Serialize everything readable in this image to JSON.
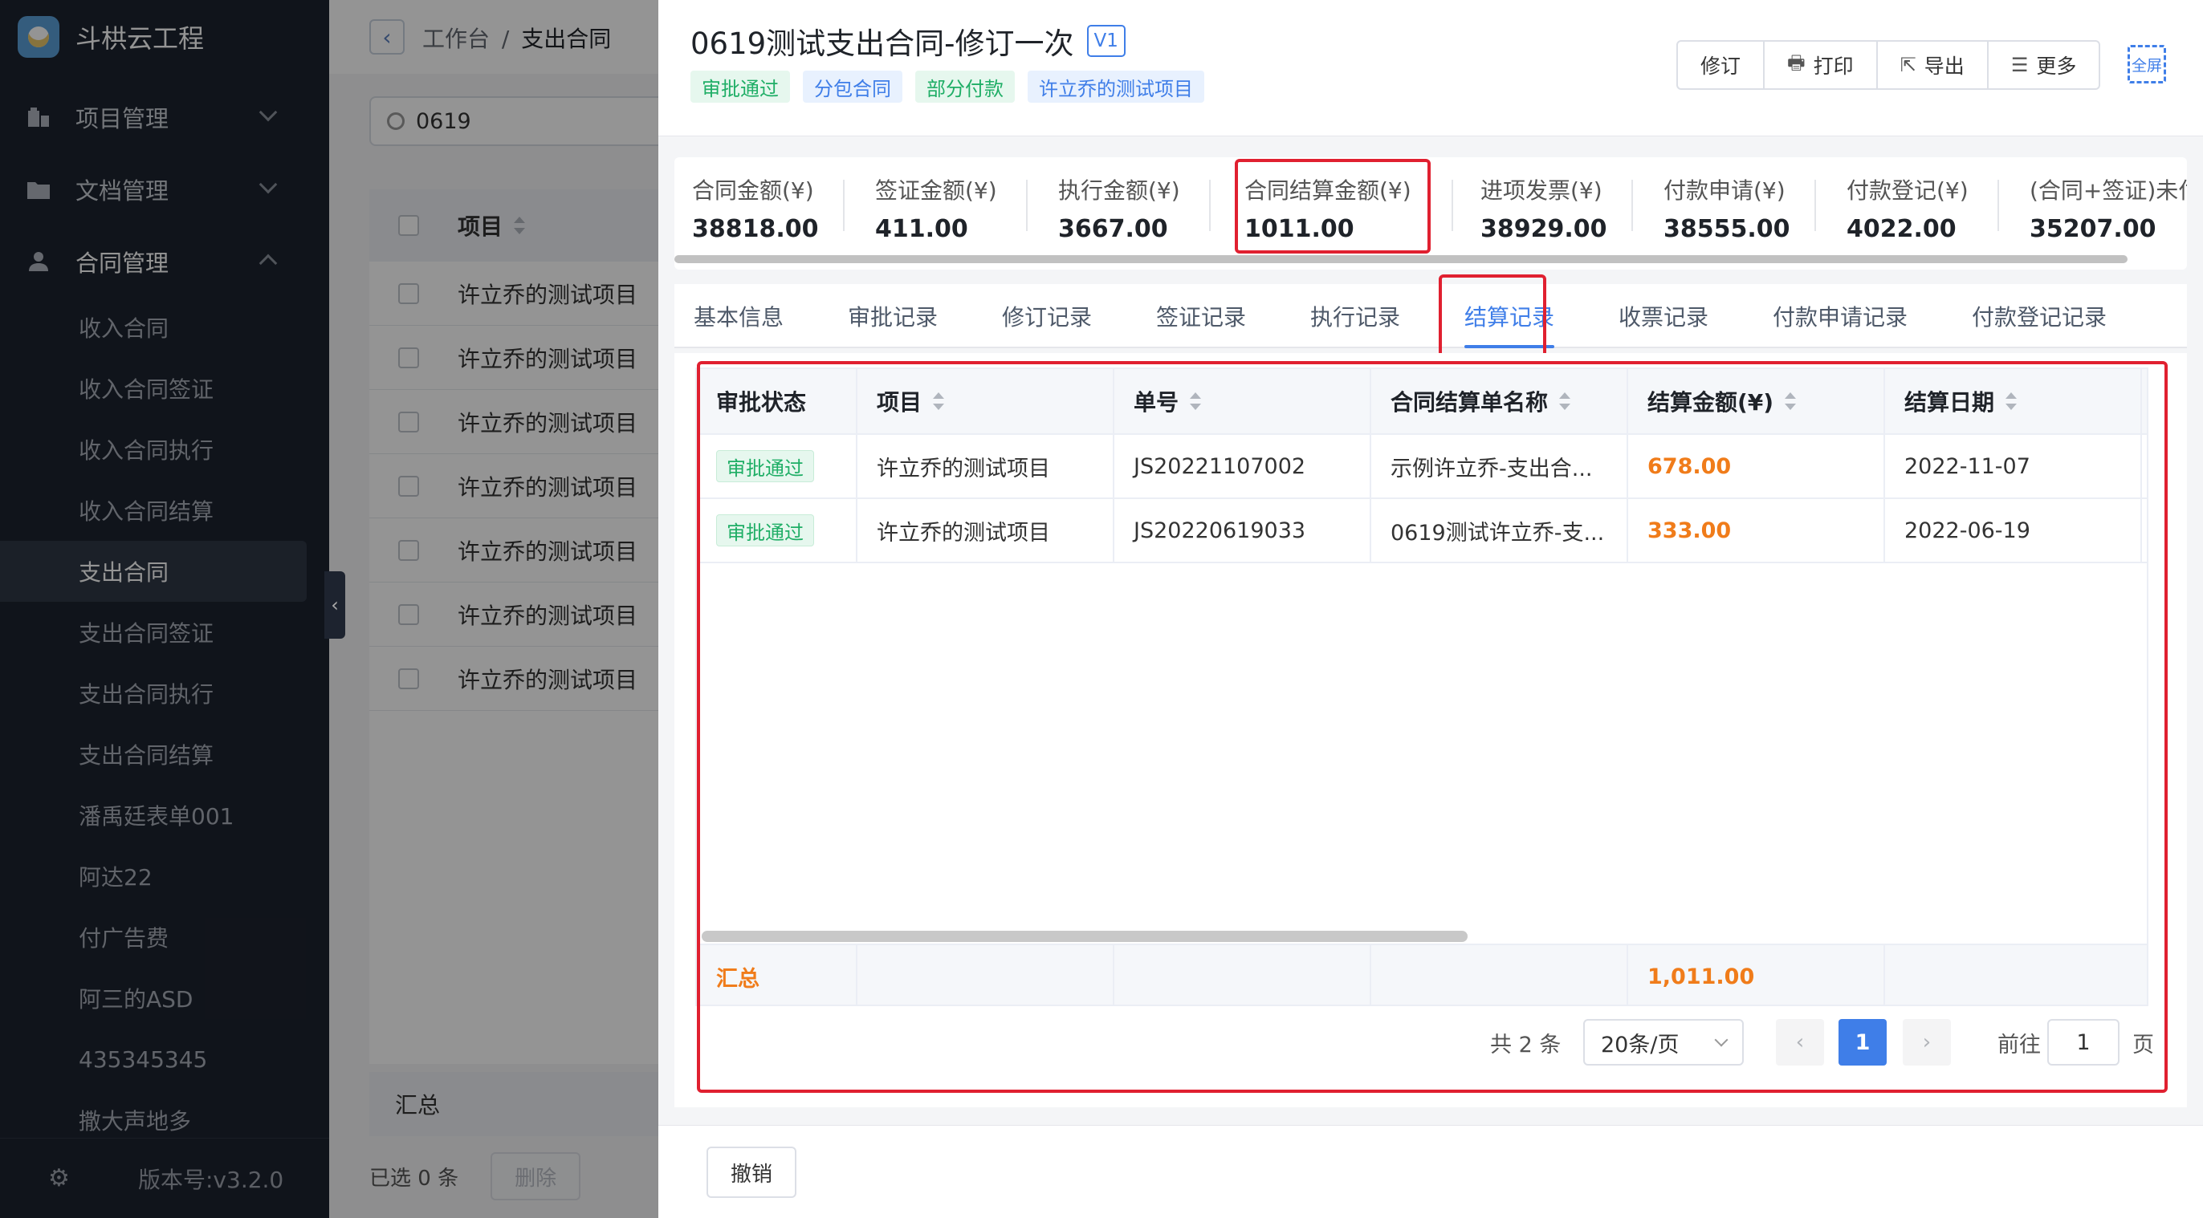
{
  "app": {
    "name": "斗栱云工程",
    "version_label": "版本号:v3.2.0"
  },
  "sidebar": {
    "groups": [
      {
        "label": "项目管理",
        "icon": "building-icon"
      },
      {
        "label": "文档管理",
        "icon": "folder-icon"
      },
      {
        "label": "合同管理",
        "icon": "user-icon"
      }
    ],
    "items": [
      {
        "label": "收入合同"
      },
      {
        "label": "收入合同签证"
      },
      {
        "label": "收入合同执行"
      },
      {
        "label": "收入合同结算"
      },
      {
        "label": "支出合同"
      },
      {
        "label": "支出合同签证"
      },
      {
        "label": "支出合同执行"
      },
      {
        "label": "支出合同结算"
      },
      {
        "label": "潘禹廷表单001"
      },
      {
        "label": "阿达22"
      },
      {
        "label": "付广告费"
      },
      {
        "label": "阿三的ASD"
      },
      {
        "label": "435345345"
      },
      {
        "label": "撒大声地多"
      }
    ],
    "active_item": "支出合同"
  },
  "background": {
    "breadcrumb": {
      "root": "工作台",
      "sep": "/",
      "current": "支出合同"
    },
    "search": {
      "value": "0619"
    },
    "table": {
      "header": "项目",
      "rows": [
        "许立乔的测试项目",
        "许立乔的测试项目",
        "许立乔的测试项目",
        "许立乔的测试项目",
        "许立乔的测试项目",
        "许立乔的测试项目",
        "许立乔的测试项目"
      ]
    },
    "summary_label": "汇总",
    "selected_text": "已选 0 条",
    "delete_label": "删除"
  },
  "drawer": {
    "title": "0619测试支出合同-修订一次",
    "version": "V1",
    "tags": [
      "审批通过",
      "分包合同",
      "部分付款",
      "许立乔的测试项目"
    ],
    "actions": [
      {
        "label": "修订",
        "icon": ""
      },
      {
        "label": "打印",
        "icon": "🖶"
      },
      {
        "label": "导出",
        "icon": "⇱"
      },
      {
        "label": "更多",
        "icon": "☰"
      }
    ],
    "fullscreen_label": "全屏",
    "stats": [
      {
        "label": "合同金额(¥)",
        "value": "38818.00"
      },
      {
        "label": "签证金额(¥)",
        "value": "411.00"
      },
      {
        "label": "执行金额(¥)",
        "value": "3667.00"
      },
      {
        "label": "合同结算金额(¥)",
        "value": "1011.00"
      },
      {
        "label": "进项发票(¥)",
        "value": "38929.00"
      },
      {
        "label": "付款申请(¥)",
        "value": "38555.00"
      },
      {
        "label": "付款登记(¥)",
        "value": "4022.00"
      },
      {
        "label": "(合同+签证)未付",
        "value": "35207.00"
      }
    ],
    "tabs": [
      "基本信息",
      "审批记录",
      "修订记录",
      "签证记录",
      "执行记录",
      "结算记录",
      "收票记录",
      "付款申请记录",
      "付款登记记录"
    ],
    "active_tab": "结算记录",
    "grid": {
      "columns": [
        "审批状态",
        "项目",
        "单号",
        "合同结算单名称",
        "结算金额(¥)",
        "结算日期"
      ],
      "rows": [
        {
          "status": "审批通过",
          "project": "许立乔的测试项目",
          "no": "JS20221107002",
          "name": "示例许立乔-支出合...",
          "amount": "678.00",
          "date": "2022-11-07"
        },
        {
          "status": "审批通过",
          "project": "许立乔的测试项目",
          "no": "JS20220619033",
          "name": "0619测试许立乔-支...",
          "amount": "333.00",
          "date": "2022-06-19"
        }
      ],
      "summary_label": "汇总",
      "summary_amount": "1,011.00"
    },
    "pagination": {
      "total": "共 2 条",
      "page_size": "20条/页",
      "current_page": "1",
      "goto_prefix": "前往",
      "goto_value": "1",
      "goto_suffix": "页"
    },
    "cancel_label": "撤销"
  },
  "colors": {
    "accent": "#3f7ee8",
    "success": "#1fae66",
    "amount": "#f07c1a",
    "highlight": "#e02030",
    "sidebar_bg": "#1d232f"
  }
}
